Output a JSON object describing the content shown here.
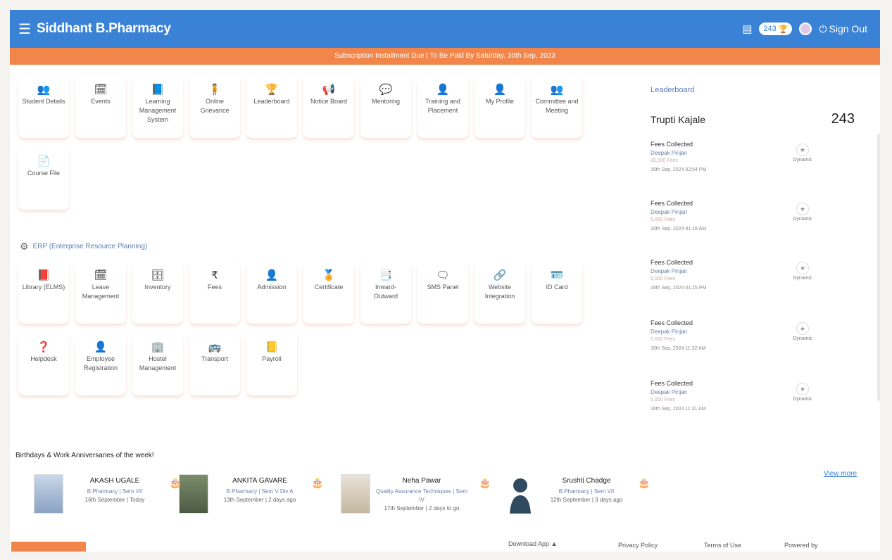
{
  "header": {
    "brand": "Siddhant B.Pharmacy",
    "points": "243",
    "sign_out": "Sign Out"
  },
  "notice": "Subscription Installment Due | To Be Paid By Saturday, 30th Sep, 2023",
  "modules": [
    {
      "label": "Student Details",
      "icon": "users-icon"
    },
    {
      "label": "Events",
      "icon": "calendar-icon"
    },
    {
      "label": "Learning Management System",
      "icon": "book-icon"
    },
    {
      "label": "Online Grievance",
      "icon": "person-icon"
    },
    {
      "label": "Leaderboard",
      "icon": "trophy-icon"
    },
    {
      "label": "Notice Board",
      "icon": "megaphone-icon"
    },
    {
      "label": "Mentoring",
      "icon": "chat-icon"
    },
    {
      "label": "Training and Placement",
      "icon": "person-icon"
    },
    {
      "label": "My Profile",
      "icon": "user-icon"
    },
    {
      "label": "Committee and Meeting",
      "icon": "group-icon"
    },
    {
      "label": "Course File",
      "icon": "file-icon"
    }
  ],
  "erp_title": "ERP (Enterprise Resource Planning)",
  "erp_modules": [
    {
      "label": "Library (ELMS)",
      "icon": "book-icon"
    },
    {
      "label": "Leave Management",
      "icon": "calendar-icon"
    },
    {
      "label": "Inventory",
      "icon": "box-icon"
    },
    {
      "label": "Fees",
      "icon": "rupee-icon"
    },
    {
      "label": "Admission",
      "icon": "user-plus-icon"
    },
    {
      "label": "Certificate",
      "icon": "certificate-icon"
    },
    {
      "label": "Inward-Outward",
      "icon": "document-icon"
    },
    {
      "label": "SMS Panel",
      "icon": "message-icon"
    },
    {
      "label": "Website Integration",
      "icon": "link-icon"
    },
    {
      "label": "ID Card",
      "icon": "id-card-icon"
    },
    {
      "label": "Helpdesk",
      "icon": "help-icon"
    },
    {
      "label": "Employee Registration",
      "icon": "user-icon"
    },
    {
      "label": "Hostel Management",
      "icon": "building-icon"
    },
    {
      "label": "Transport",
      "icon": "bus-icon"
    },
    {
      "label": "Payroll",
      "icon": "ledger-icon"
    }
  ],
  "leaderboard": {
    "title": "Leaderboard",
    "top_name": "Trupti Kajale",
    "top_score": "243",
    "entries": [
      {
        "title": "Fees Collected",
        "by": "Deepak Pinjan",
        "amount": "20,000 Fees",
        "time": "16th Sep, 2024 02:54 PM",
        "badge": "Dynamic"
      },
      {
        "title": "Fees Collected",
        "by": "Deepak Pinjan",
        "amount": "5,000 Fees",
        "time": "16th Sep, 2024 01:16 AM",
        "badge": "Dynamic"
      },
      {
        "title": "Fees Collected",
        "by": "Deepak Pinjan",
        "amount": "5,000 Fees",
        "time": "16th Sep, 2024 01:25 PM",
        "badge": "Dynamic"
      },
      {
        "title": "Fees Collected",
        "by": "Deepak Pinjan",
        "amount": "5,000 Fees",
        "time": "16th Sep, 2024 11:32 AM",
        "badge": "Dynamic"
      },
      {
        "title": "Fees Collected",
        "by": "Deepak Pinjan",
        "amount": "5,000 Fees",
        "time": "16th Sep, 2024 11:31 AM",
        "badge": "Dynamic"
      }
    ]
  },
  "birthdays": {
    "title": "Birthdays & Work Anniversaries of the week!",
    "view_more": "View more",
    "people": [
      {
        "name": "AKASH UGALE",
        "dept": "B.Pharmacy | Sem VII",
        "time": "16th September | Today"
      },
      {
        "name": "ANKITA GAVARE",
        "dept": "B.Pharmacy | Sem V Div A",
        "time": "13th September | 2 days ago"
      },
      {
        "name": "Neha Pawar",
        "dept": "Quality Assurance Techniques | Sem IV",
        "time": "17th September | 2 days to go"
      },
      {
        "name": "Srushti Chadge",
        "dept": "B.Pharmacy | Sem VII",
        "time": "12th September | 3 days ago"
      }
    ]
  },
  "footer": {
    "download": "Download App",
    "privacy": "Privacy Policy",
    "terms": "Terms of Use",
    "powered": "Powered by"
  }
}
